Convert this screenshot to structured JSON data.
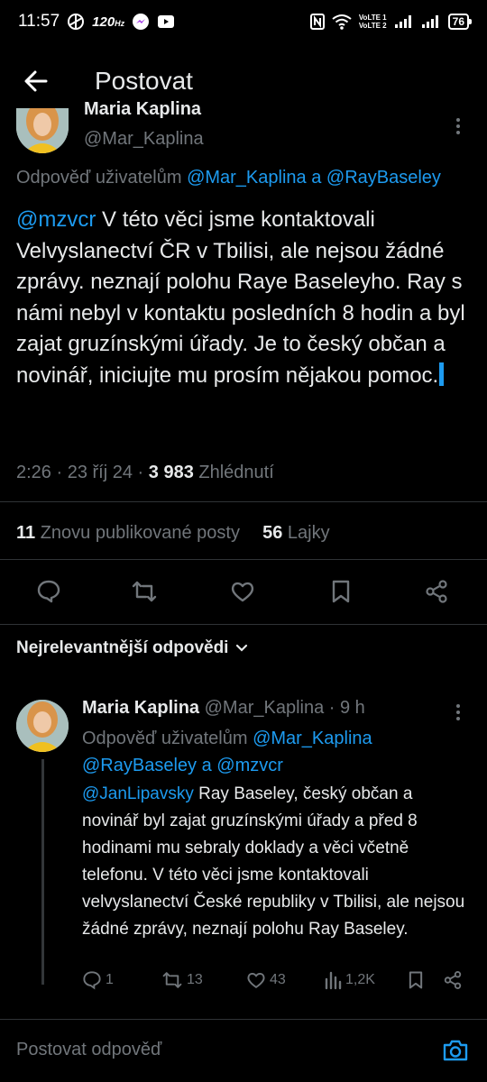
{
  "status_bar": {
    "time": "11:57",
    "refresh_rate": "120",
    "network_1": "VoLTE 1",
    "network_2": "VoLTE 2",
    "battery": "76"
  },
  "header": {
    "title": "Postovat"
  },
  "main_post": {
    "author_name": "Maria Kaplina",
    "author_handle": "@Mar_Kaplina",
    "reply_to_prefix": "Odpověď uživatelům ",
    "reply_to_user1": "@Mar_Kaplina",
    "reply_to_and": " a ",
    "reply_to_user2": "@RayBaseley",
    "mention": "@mzvcr",
    "text": " V této věci jsme kontaktovali Velvyslanectví ČR v Tbilisi, ale nejsou žádné zprávy. neznají polohu Raye Baseleyho. Ray s námi nebyl v kontaktu posledních 8 hodin a byl zajat gruzínskými úřady. Je to český občan a novinář, iniciujte mu prosím nějakou pomoc.",
    "time": "2:26",
    "date": "23 říj 24",
    "views": "3 983",
    "views_label": "Zhlédnutí",
    "reposts": "11",
    "reposts_label": "Znovu publikované posty",
    "likes": "56",
    "likes_label": "Lajky"
  },
  "sort": {
    "label": "Nejrelevantnější odpovědi"
  },
  "reply": {
    "author_name": "Maria Kaplina",
    "author_handle": "@Mar_Kaplina",
    "age": "9 h",
    "reply_to_prefix": "Odpověď uživatelům ",
    "reply_to_user1": "@Mar_Kaplina",
    "reply_to_user2": "@RayBaseley",
    "reply_to_and": " a ",
    "reply_to_user3": "@mzvcr",
    "mention": "@JanLipavsky",
    "text": " Ray Baseley, český občan a novinář byl zajat gruzínskými úřady a před 8 hodinami mu sebraly doklady a věci včetně telefonu. V této věci jsme kontaktovali velvyslanectví České republiky v Tbilisi, ale nejsou žádné zprávy, neznají polohu Ray Baseley.",
    "replies": "1",
    "reposts": "13",
    "likes": "43",
    "views": "1,2K"
  },
  "composer": {
    "placeholder": "Postovat odpověď"
  },
  "colors": {
    "accent": "#1d9bf0",
    "muted": "#71767b",
    "text": "#e7e9ea",
    "background": "#000000"
  }
}
